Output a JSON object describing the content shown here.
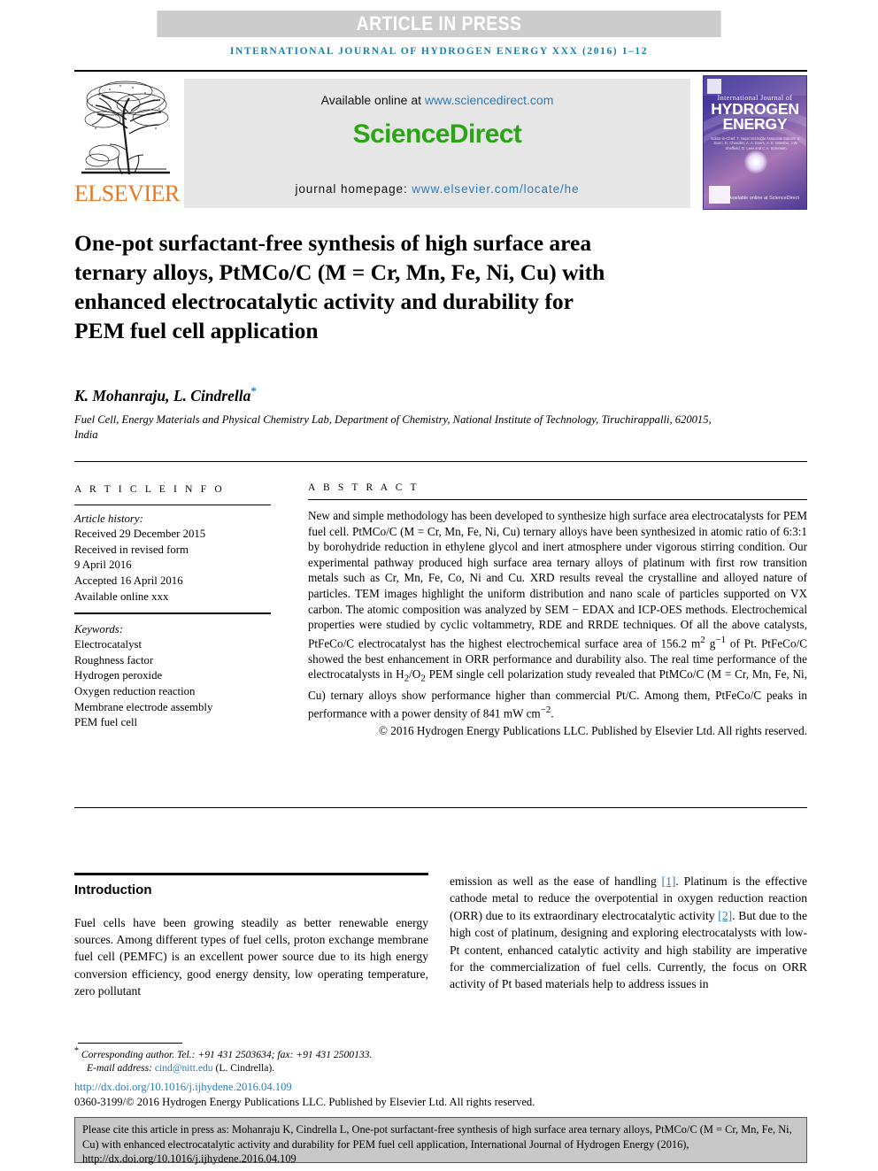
{
  "banner": {
    "press_label": "ARTICLE IN PRESS",
    "journal_running_head": "INTERNATIONAL JOURNAL OF HYDROGEN ENERGY XXX (2016) 1–12"
  },
  "masthead": {
    "publisher_name": "ELSEVIER",
    "available_prefix": "Available online at ",
    "available_url": "www.sciencedirect.com",
    "sciencedirect_logo": "ScienceDirect",
    "homepage_label": "journal homepage: ",
    "homepage_url": "www.elsevier.com/locate/he",
    "cover": {
      "line_small": "International Journal of",
      "line_big_1": "HYDROGEN",
      "line_big_2": "ENERGY",
      "editors": "Editor-in-Chief: T. Nejat Veziroğlu   Associate Editors: S. Dunn, D. Chandler, A. A. Evers, A. E. Mansbo, J.W. Sheffield, D. Lewi and C.A. Sorensen",
      "sciencedirect_tag": "Available online at ScienceDirect"
    }
  },
  "article": {
    "title": "One-pot surfactant-free synthesis of high surface area ternary alloys, PtMCo/C (M = Cr, Mn, Fe, Ni, Cu) with enhanced electrocatalytic activity and durability for PEM fuel cell application",
    "authors": "K. Mohanraju, L. Cindrella",
    "corresponding_marker": "*",
    "affiliation": "Fuel Cell, Energy Materials and Physical Chemistry Lab, Department of Chemistry, National Institute of Technology, Tiruchirappalli, 620015, India"
  },
  "article_info": {
    "heading": "A R T I C L E   I N F O",
    "history_label": "Article history:",
    "history_lines": [
      "Received 29 December 2015",
      "Received in revised form",
      "9 April 2016",
      "Accepted 16 April 2016",
      "Available online xxx"
    ],
    "keywords_label": "Keywords:",
    "keywords": [
      "Electrocatalyst",
      "Roughness factor",
      "Hydrogen peroxide",
      "Oxygen reduction reaction",
      "Membrane electrode assembly",
      "PEM fuel cell"
    ]
  },
  "abstract": {
    "heading": "A B S T R A C T",
    "text_part_1": "New and simple methodology has been developed to synthesize high surface area electrocatalysts for PEM fuel cell. PtMCo/C (M = Cr, Mn, Fe, Ni, Cu) ternary alloys have been synthesized in atomic ratio of 6:3:1 by borohydride reduction in ethylene glycol and inert atmosphere under vigorous stirring condition. Our experimental pathway produced high surface area ternary alloys of platinum with first row transition metals such as Cr, Mn, Fe, Co, Ni and Cu. XRD results reveal the crystalline and alloyed nature of particles. TEM images highlight the uniform distribution and nano scale of particles supported on VX carbon. The atomic composition was analyzed by SEM − EDAX and ICP-OES methods. Electrochemical properties were studied by cyclic voltammetry, RDE and RRDE techniques. Of all the above catalysts, PtFeCo/C electrocatalyst has the highest electrochemical surface area of 156.2 m",
    "sup_1": "2",
    "text_part_2": " g",
    "sup_2": "−1",
    "text_part_3": " of Pt. PtFeCo/C showed the best enhancement in ORR performance and durability also. The real time performance of the electrocatalysts in H",
    "sub_1": "2",
    "text_part_4": "/O",
    "sub_2": "2",
    "text_part_5": " PEM single cell polarization study revealed that PtMCo/C (M = Cr, Mn, Fe, Ni, Cu) ternary alloys show performance higher than commercial Pt/C. Among them, PtFeCo/C peaks in performance with a power density of 841 mW cm",
    "sup_3": "−2",
    "text_part_6": ".",
    "copyright": "© 2016 Hydrogen Energy Publications LLC. Published by Elsevier Ltd. All rights reserved."
  },
  "introduction": {
    "heading": "Introduction",
    "left_paragraph": "Fuel cells have been growing steadily as better renewable energy sources. Among different types of fuel cells, proton exchange membrane fuel cell (PEMFC) is an excellent power source due to its high energy conversion efficiency, good energy density, low operating temperature, zero pollutant",
    "right_part_1": "emission as well as the ease of handling ",
    "right_ref_1": "[1]",
    "right_part_2": ". Platinum is the effective cathode metal to reduce the overpotential in oxygen reduction reaction (ORR) due to its extraordinary electrocatalytic activity ",
    "right_ref_2": "[2]",
    "right_part_3": ". But due to the high cost of platinum, designing and exploring electrocatalysts with low-Pt content, enhanced catalytic activity and high stability are imperative for the commercialization of fuel cells. Currently, the focus on ORR activity of Pt based materials help to address issues in"
  },
  "footnotes": {
    "corresponding": "Corresponding author. Tel.: +91 431 2503634; fax: +91 431 2500133.",
    "email_label": "E-mail address: ",
    "email": "cind@nitt.edu",
    "email_suffix": " (L. Cindrella).",
    "doi_url": "http://dx.doi.org/10.1016/j.ijhydene.2016.04.109",
    "issn_line": "0360-3199/© 2016 Hydrogen Energy Publications LLC. Published by Elsevier Ltd. All rights reserved."
  },
  "citation_box": {
    "text": "Please cite this article in press as: Mohanraju K, Cindrella L, One-pot surfactant-free synthesis of high surface area ternary alloys, PtMCo/C (M = Cr, Mn, Fe, Ni, Cu) with enhanced electrocatalytic activity and durability for PEM fuel cell application, International Journal of Hydrogen Energy (2016), http://dx.doi.org/10.1016/j.ijhydene.2016.04.109"
  },
  "colors": {
    "banner_gray": "#cccccc",
    "link_blue": "#2b7bb9",
    "journal_blue": "#1a7fa8",
    "sciencedirect_green": "#2aa515",
    "elsevier_orange": "#e87722",
    "cite_box_gray": "#c8c8c8"
  }
}
